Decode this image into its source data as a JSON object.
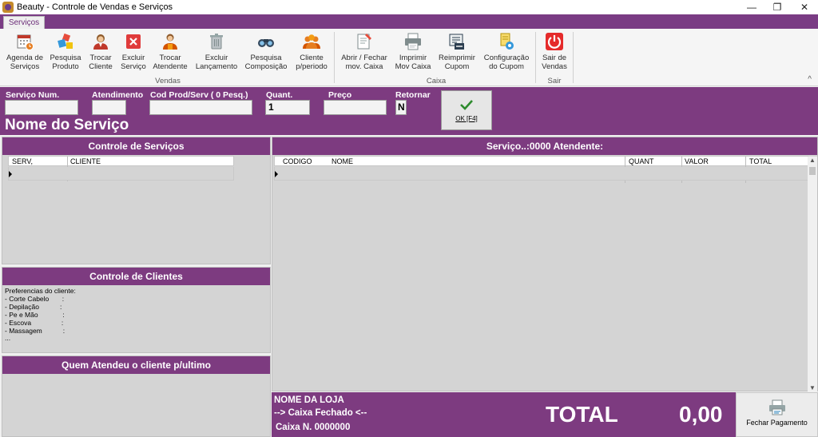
{
  "window": {
    "title": "Beauty - Controle de Vendas e Serviços",
    "minimize_glyph": "—",
    "restore_glyph": "❐",
    "close_glyph": "✕"
  },
  "ribbon": {
    "tab": "Serviços",
    "groups": {
      "vendas": "Vendas",
      "caixa": "Caixa",
      "sair": "Sair"
    },
    "buttons": {
      "agenda": [
        "Agenda de",
        "Serviços"
      ],
      "pesquisa_produto": [
        "Pesquisa",
        "Produto"
      ],
      "trocar_cliente": [
        "Trocar",
        "Cliente"
      ],
      "excluir_servico": [
        "Excluir",
        "Serviço"
      ],
      "trocar_atendente": [
        "Trocar",
        "Atendente"
      ],
      "excluir_lancamento": [
        "Excluir",
        "Lançamento"
      ],
      "pesquisa_composicao": [
        "Pesquisa",
        "Composição"
      ],
      "cliente_periodo": [
        "Cliente",
        "p/periodo"
      ],
      "abrir_fechar": [
        "Abrir / Fechar",
        "mov. Caixa"
      ],
      "imprimir": [
        "Imprimir",
        "Mov Caixa"
      ],
      "reimprimir": [
        "Reimprimir",
        "Cupom"
      ],
      "configuracao": [
        "Configuração",
        "do Cupom"
      ],
      "sair": [
        "Sair de",
        "Vendas"
      ]
    },
    "collapse_glyph": "^"
  },
  "entry": {
    "servico_num_label": "Serviço Num.",
    "servico_num_value": "",
    "atendimento_label": "Atendimento",
    "atendimento_value": "",
    "cod_label": "Cod Prod/Serv ( 0 Pesq.)",
    "cod_value": "",
    "quant_label": "Quant.",
    "quant_value": "1",
    "preco_label": "Preço",
    "preco_value": "",
    "retornar_label": "Retornar",
    "retornar_value": "N",
    "nome_servico": "Nome do Serviço",
    "ok_label": "OK [F4]"
  },
  "controle_servicos": {
    "title": "Controle de Serviços",
    "columns": [
      "SERV,",
      "CLIENTE"
    ]
  },
  "controle_clientes": {
    "title": "Controle de Clientes",
    "preferences_title": "Preferencias do cliente:",
    "preferences": [
      "- Corte Cabelo       :",
      "- Depilação           :",
      "- Pe e Mão             :",
      "- Escova                :",
      "- Massagem           :",
      "..."
    ]
  },
  "quem_atendeu": {
    "title": "Quem Atendeu o cliente p/ultimo"
  },
  "servico_grid": {
    "title": "Serviço..:0000  Atendente:",
    "columns": [
      "CODIGO",
      "NOME",
      "QUANT",
      "VALOR",
      "TOTAL"
    ]
  },
  "footer": {
    "loja": "NOME DA LOJA",
    "caixa_status": "--> Caixa Fechado <--",
    "caixa_num": "Caixa N. 0000000",
    "total_label": "TOTAL",
    "total_value": "0,00",
    "fechar_pagamento": "Fechar Pagamento"
  },
  "colors": {
    "accent": "#7d3b80",
    "ribbon_bg": "#f5f5f5",
    "panel_bg": "#d4d4d4"
  }
}
